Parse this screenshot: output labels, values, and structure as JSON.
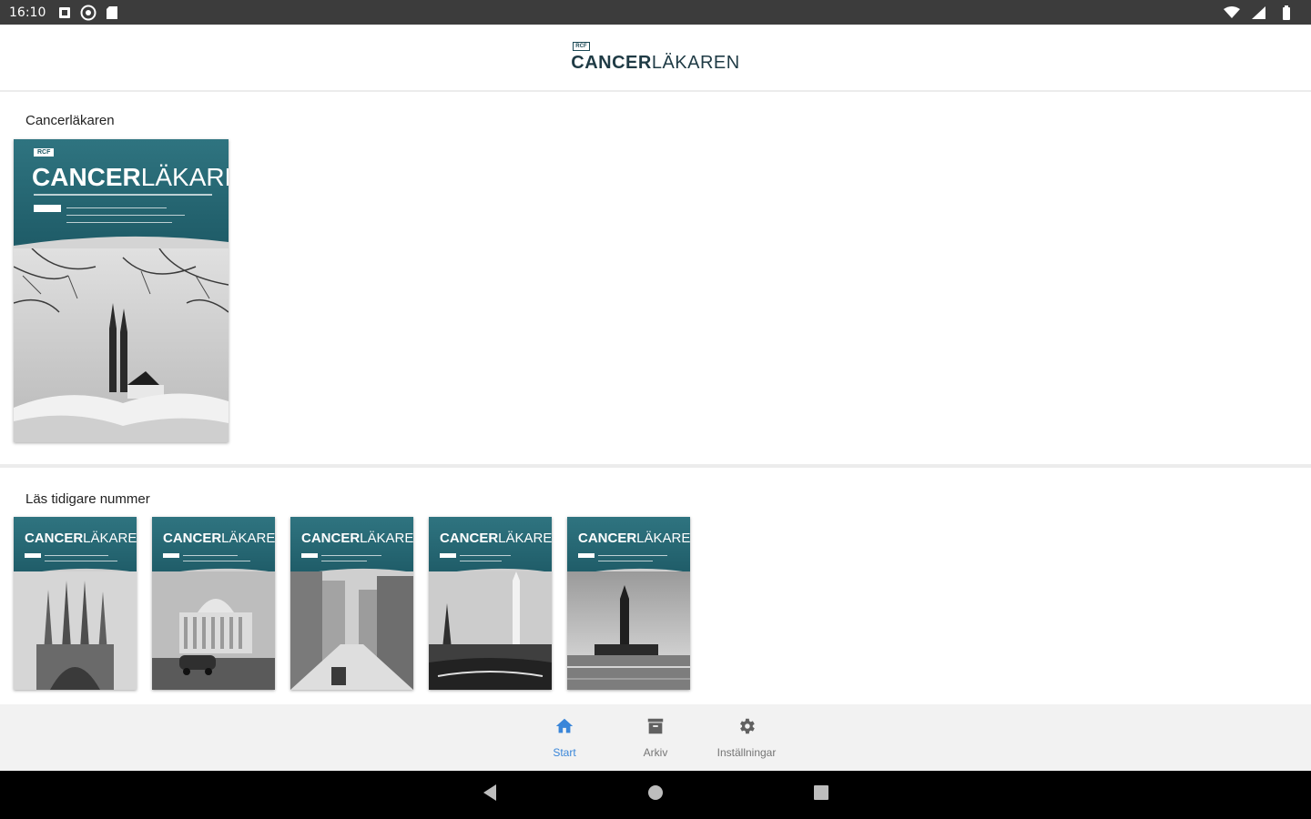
{
  "status_bar": {
    "time": "16:10",
    "left_icons": [
      "notification-icon",
      "accessibility-icon",
      "sd-card-icon"
    ],
    "right_icons": [
      "wifi-icon",
      "signal-icon",
      "battery-icon"
    ]
  },
  "header": {
    "logo_badge": "RCF",
    "logo_bold": "CANCER",
    "logo_light": "LÄKAREN"
  },
  "current_issue": {
    "section_title": "Cancerläkaren",
    "cover": {
      "badge": "RCF",
      "title_bold": "CANCER",
      "title_light": "LÄKAREN"
    }
  },
  "archive": {
    "section_title": "Läs tidigare nummer",
    "covers": [
      {
        "title_bold": "CANCER",
        "title_light": "LÄKAREN",
        "scene": "cathedral"
      },
      {
        "title_bold": "CANCER",
        "title_light": "LÄKAREN",
        "scene": "capitol-street"
      },
      {
        "title_bold": "CANCER",
        "title_light": "LÄKAREN",
        "scene": "city-street"
      },
      {
        "title_bold": "CANCER",
        "title_light": "LÄKAREN",
        "scene": "city-skyline"
      },
      {
        "title_bold": "CANCER",
        "title_light": "LÄKAREN",
        "scene": "waterfront-tower"
      }
    ]
  },
  "bottom_nav": {
    "items": [
      {
        "label": "Start",
        "icon": "home-icon",
        "active": true
      },
      {
        "label": "Arkiv",
        "icon": "archive-icon",
        "active": false
      },
      {
        "label": "Inställningar",
        "icon": "gear-icon",
        "active": false
      }
    ]
  },
  "colors": {
    "accent": "#3a86d9",
    "cover_teal": "#1d5965",
    "status_bar": "#3c3c3c"
  }
}
